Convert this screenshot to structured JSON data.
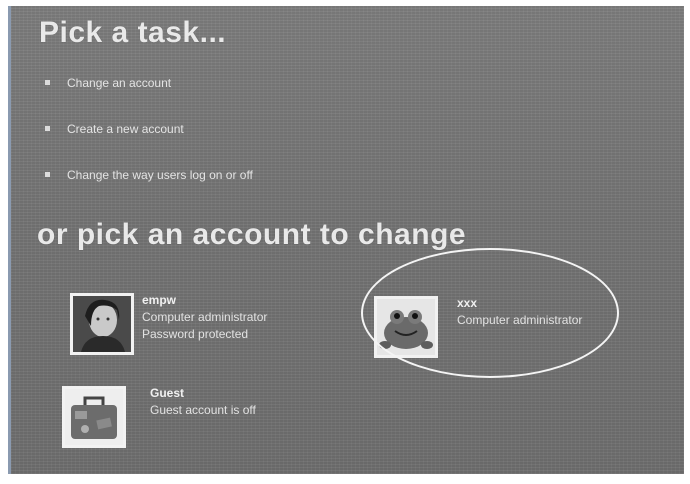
{
  "task_section": {
    "title": "Pick a task...",
    "items": [
      {
        "label": "Change an account"
      },
      {
        "label": "Create a new account"
      },
      {
        "label": "Change the way users log on or off"
      }
    ]
  },
  "account_section": {
    "title": "or pick an account to change",
    "accounts": [
      {
        "name": "empw",
        "line1": "Computer administrator",
        "line2": "Password protected",
        "picture": "portrait-photo"
      },
      {
        "name": "xxx",
        "line1": "Computer administrator",
        "line2": "",
        "picture": "frog-picture"
      },
      {
        "name": "Guest",
        "line1": "Guest account is off",
        "line2": "",
        "picture": "suitcase-picture"
      }
    ]
  },
  "colors": {
    "panel_background": "#757575",
    "heading_text": "#e9e9e9",
    "body_text": "#e2e2e2",
    "highlight_outline": "#f4f4f4"
  }
}
